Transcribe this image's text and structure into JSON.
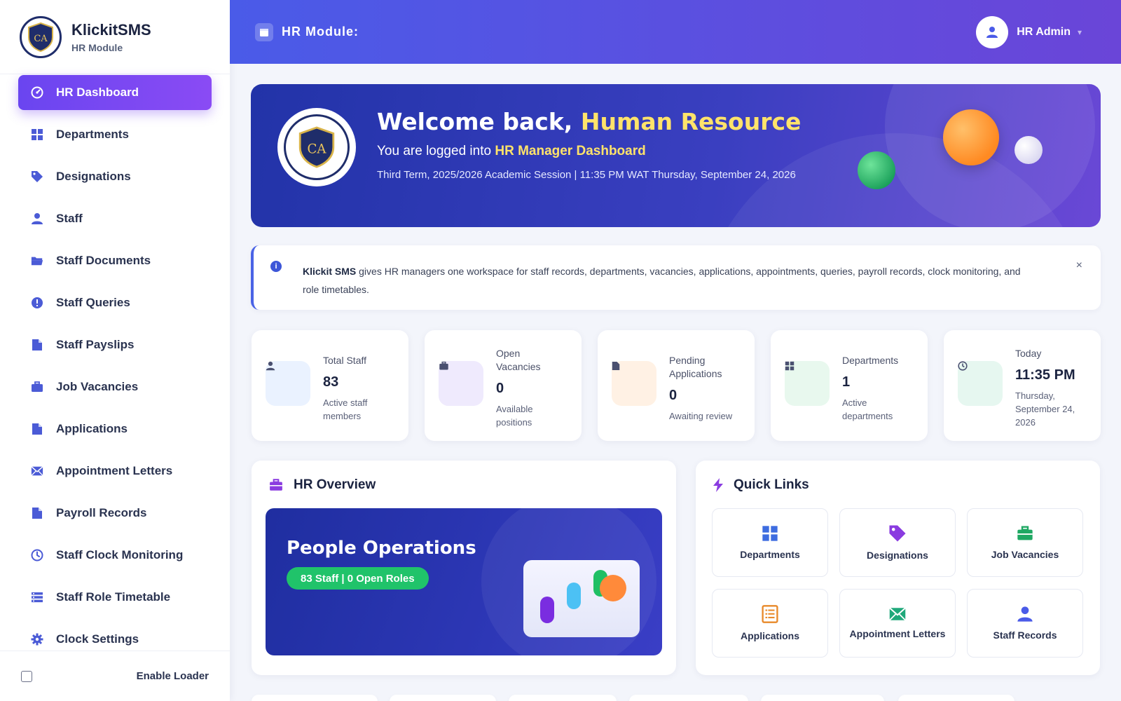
{
  "brand": {
    "logo_text": "CA",
    "name": "KlickitSMS",
    "subtitle": "HR Module"
  },
  "sidebar": {
    "items": [
      {
        "label": "HR Dashboard",
        "icon": "dashboard-icon",
        "active": true
      },
      {
        "label": "Departments",
        "icon": "grid-icon"
      },
      {
        "label": "Designations",
        "icon": "tag-icon"
      },
      {
        "label": "Staff",
        "icon": "user-icon"
      },
      {
        "label": "Staff Documents",
        "icon": "folder-icon"
      },
      {
        "label": "Staff Queries",
        "icon": "alert-circle-icon"
      },
      {
        "label": "Staff Payslips",
        "icon": "file-icon"
      },
      {
        "label": "Job Vacancies",
        "icon": "briefcase-icon"
      },
      {
        "label": "Applications",
        "icon": "file-icon"
      },
      {
        "label": "Appointment Letters",
        "icon": "envelope-icon"
      },
      {
        "label": "Payroll Records",
        "icon": "file-icon"
      },
      {
        "label": "Staff Clock Monitoring",
        "icon": "clock-icon"
      },
      {
        "label": "Staff Role Timetable",
        "icon": "list-icon"
      },
      {
        "label": "Clock Settings",
        "icon": "gear-icon"
      }
    ],
    "footer_label": "Enable Loader"
  },
  "header": {
    "title": "HR Module:",
    "user": "HR Admin"
  },
  "welcome": {
    "greeting": "Welcome back,",
    "name": "Human Resource",
    "line_prefix": "You are logged into",
    "dashboard": "HR Manager Dashboard",
    "meta": "Third Term, 2025/2026 Academic Session | 11:35 PM WAT Thursday, September 24, 2026"
  },
  "alert": {
    "brand": "Klickit SMS",
    "text": "gives HR managers one workspace for staff records, departments, vacancies, applications, appointments, queries, payroll records, clock monitoring, and role timetables.",
    "close": "×"
  },
  "stats": [
    {
      "label": "Total Staff",
      "value": "83",
      "sub": "Active staff members",
      "icon": "user-icon",
      "color": "#eaf2ff"
    },
    {
      "label": "Open Vacancies",
      "value": "0",
      "sub": "Available positions",
      "icon": "briefcase-icon",
      "color": "#efeafd"
    },
    {
      "label": "Pending Applications",
      "value": "0",
      "sub": "Awaiting review",
      "icon": "file-icon",
      "color": "#fff1e4"
    },
    {
      "label": "Departments",
      "value": "1",
      "sub": "Active departments",
      "icon": "grid-icon",
      "color": "#e8f8ee"
    },
    {
      "label": "Today",
      "value": "11:35 PM",
      "sub": "Thursday, September 24, 2026",
      "icon": "clock-icon",
      "color": "#e6f7f0"
    }
  ],
  "overview": {
    "title": "HR Overview",
    "card_title": "People Operations",
    "badge": "83 Staff | 0 Open Roles"
  },
  "quick_links": {
    "title": "Quick Links",
    "items": [
      {
        "label": "Departments",
        "icon": "grid-icon",
        "color": "#3d6ce0"
      },
      {
        "label": "Designations",
        "icon": "tag-icon",
        "color": "#8a3ce0"
      },
      {
        "label": "Job Vacancies",
        "icon": "briefcase-icon",
        "color": "#1fa863"
      },
      {
        "label": "Applications",
        "icon": "list-icon",
        "color": "#e8892a"
      },
      {
        "label": "Appointment Letters",
        "icon": "envelope-icon",
        "color": "#1fa87a"
      },
      {
        "label": "Staff Records",
        "icon": "user-icon",
        "color": "#4a5be8"
      }
    ]
  },
  "colors": {
    "accent": "#6a45f0",
    "header_start": "#4a5be8",
    "header_end": "#6a45d8",
    "highlight": "#ffe36a",
    "success": "#20c36a"
  }
}
